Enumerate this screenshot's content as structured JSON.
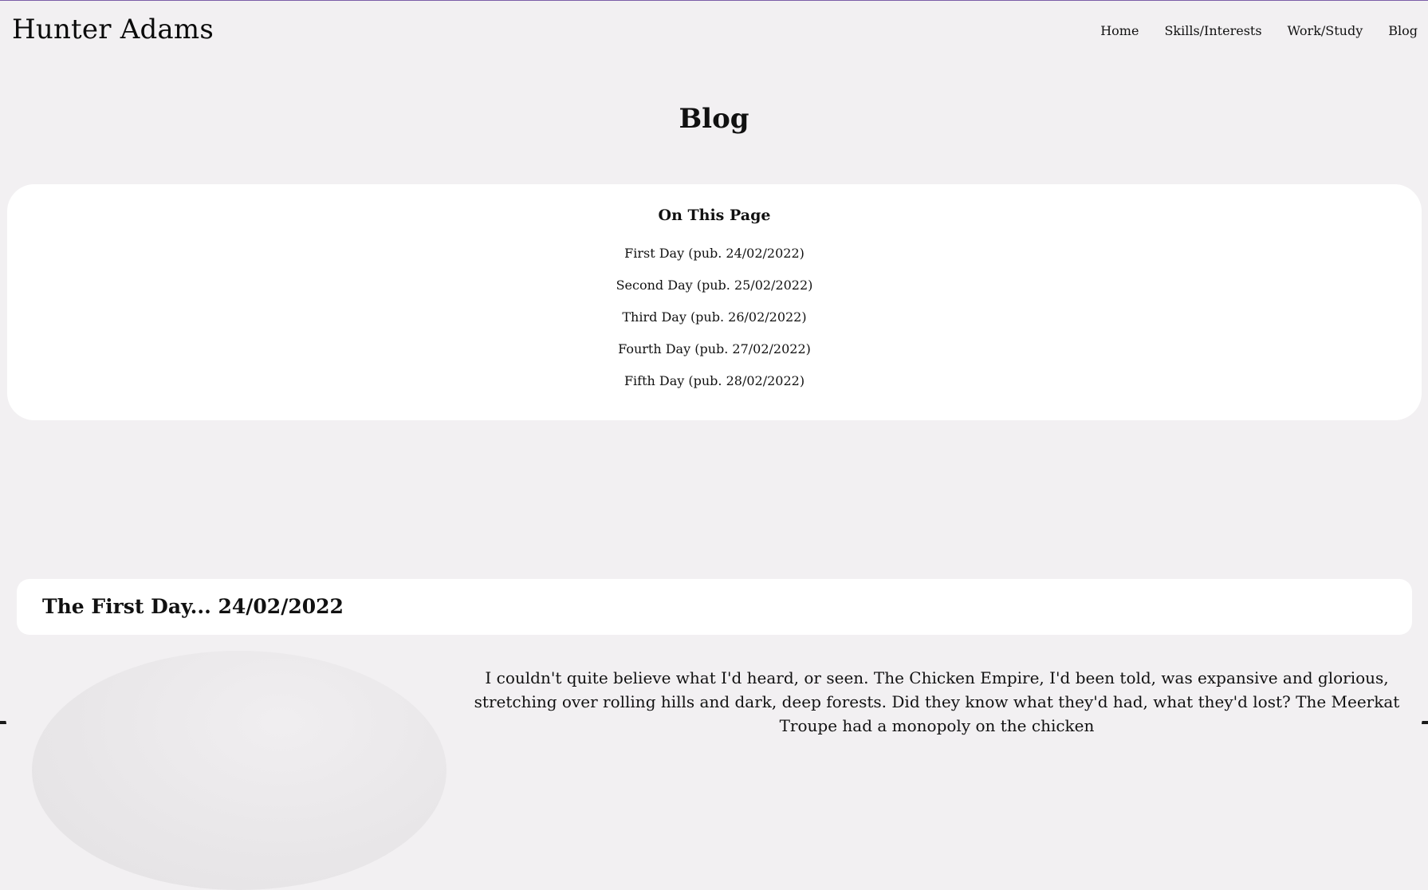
{
  "site": {
    "title": "Hunter Adams"
  },
  "nav": {
    "items": [
      {
        "label": "Home"
      },
      {
        "label": "Skills/Interests"
      },
      {
        "label": "Work/Study"
      },
      {
        "label": "Blog"
      }
    ]
  },
  "page": {
    "heading": "Blog"
  },
  "toc": {
    "title": "On This Page",
    "items": [
      {
        "label": "First Day (pub. 24/02/2022)"
      },
      {
        "label": "Second Day (pub. 25/02/2022)"
      },
      {
        "label": "Third Day (pub. 26/02/2022)"
      },
      {
        "label": "Fourth Day (pub. 27/02/2022)"
      },
      {
        "label": "Fifth Day (pub. 28/02/2022)"
      }
    ]
  },
  "post": {
    "title": "The First Day... 24/02/2022",
    "body": "I couldn't quite believe what I'd heard, or seen. The Chicken Empire, I'd been told, was expansive and glorious, stretching over rolling hills and dark, deep forests. Did they know what they'd had, what they'd lost? The Meerkat Troupe had a monopoly on the chicken"
  }
}
